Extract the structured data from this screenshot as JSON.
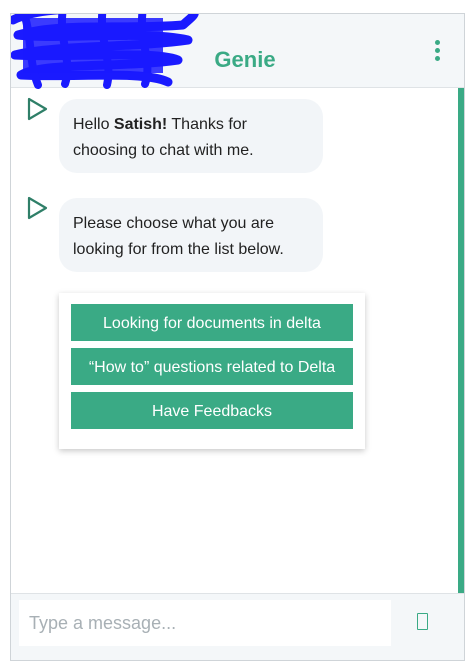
{
  "header": {
    "title": "Genie",
    "menu_icon": "vertical-dots-icon"
  },
  "messages": [
    {
      "sender_icon": "play-triangle-icon",
      "greeting": "Hello ",
      "name": "Satish!",
      "rest": " Thanks for choosing to chat with me."
    },
    {
      "sender_icon": "play-triangle-icon",
      "text": "Please choose what you are looking for from the list below."
    }
  ],
  "options": [
    {
      "label": "Looking for documents in delta"
    },
    {
      "label": "“How to” questions related to Delta"
    },
    {
      "label": "Have Feedbacks"
    }
  ],
  "composer": {
    "placeholder": "Type a message...",
    "send_icon": "send-icon"
  },
  "colors": {
    "accent": "#3aaa85",
    "bubble_bg": "#f2f5f8",
    "header_bg": "#f4f7f9",
    "redaction": "#1a1aff"
  }
}
